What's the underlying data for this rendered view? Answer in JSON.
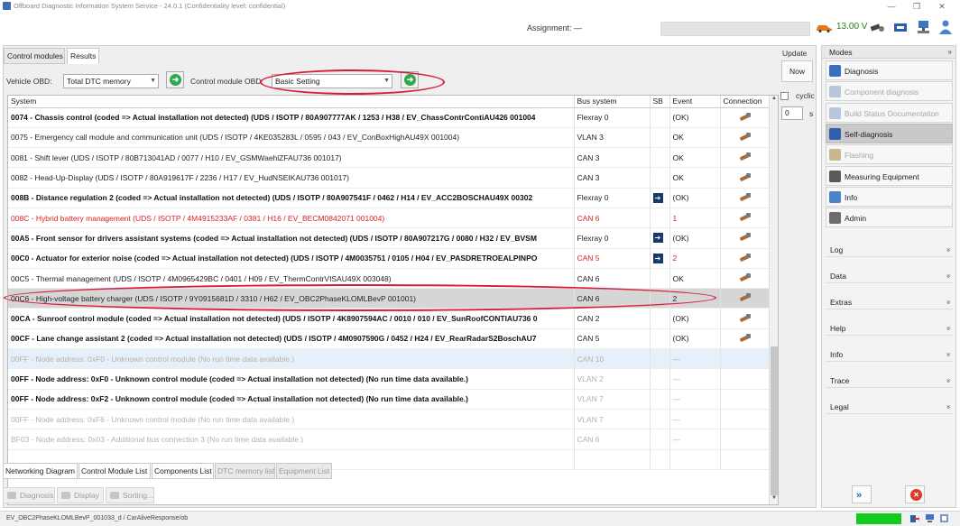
{
  "app": {
    "title": "Offboard Diagnostic Information System Service - 24.0.1 (Confidentiality level: confidential)",
    "window_buttons": [
      "—",
      "❐",
      "✕"
    ]
  },
  "topbar": {
    "assignment_label": "Assignment:  —",
    "assignment_value": "",
    "voltage": "13.00 V"
  },
  "tabs": [
    "Control modules",
    "Results"
  ],
  "filters": {
    "vehicle_obd_label": "Vehicle OBD:",
    "vehicle_obd_value": "Total DTC memory",
    "module_obd_label": "Control module OBD:",
    "module_obd_value": "Basic Setting"
  },
  "table": {
    "columns": [
      "System",
      "Bus system",
      "SB",
      "Event",
      "Connection"
    ],
    "rows": [
      {
        "system": "0074 - Chassis control  (coded => Actual installation not detected)  (UDS / ISOTP / 80A907777AK / 1253 / H38 / EV_ChassContrContiAU426 001004",
        "bus": "Flexray 0",
        "sb": false,
        "event": "(OK)",
        "style": "bold"
      },
      {
        "system": "0075 - Emergency call module and communication unit  (UDS / ISOTP / 4KE035283L / 0595 / 043 / EV_ConBoxHighAU49X 001004)",
        "bus": "VLAN 3",
        "sb": false,
        "event": "OK",
        "style": "normal"
      },
      {
        "system": "0081 - Shift lever  (UDS / ISOTP / 80B713041AD / 0077 / H10 / EV_GSMWaehlZFAU736 001017)",
        "bus": "CAN 3",
        "sb": false,
        "event": "OK",
        "style": "normal"
      },
      {
        "system": "0082 - Head-Up-Display  (UDS / ISOTP / 80A919617F / 2236 / H17 / EV_HudNSEIKAU736 001017)",
        "bus": "CAN 3",
        "sb": false,
        "event": "OK",
        "style": "normal"
      },
      {
        "system": "008B - Distance regulation 2  (coded => Actual installation not detected)  (UDS / ISOTP / 80A907541F / 0462 / H14 / EV_ACC2BOSCHAU49X 00302",
        "bus": "Flexray 0",
        "sb": true,
        "event": "(OK)",
        "style": "bold"
      },
      {
        "system": "008C - Hybrid battery management  (UDS / ISOTP / 4M4915233AF / 0381 / H16 / EV_BECM0842071 001004)",
        "bus": "CAN 6",
        "sb": false,
        "event": "1",
        "style": "red"
      },
      {
        "system": "00A5 - Front sensor for drivers assistant systems  (coded => Actual installation not detected)  (UDS / ISOTP / 80A907217G / 0080 / H32 / EV_BVSM",
        "bus": "Flexray 0",
        "sb": true,
        "event": "(OK)",
        "style": "bold"
      },
      {
        "system": "00C0 - Actuator for exterior noise  (coded => Actual installation not detected)  (UDS / ISOTP / 4M0035751 / 0105 / H04 / EV_PASDRETROEALPINPO",
        "bus": "CAN 5",
        "sb": true,
        "event": "2",
        "style": "redbold"
      },
      {
        "system": "00C5 - Thermal management  (UDS / ISOTP / 4M0965429BC / 0401 / H09 / EV_ThermContrVISAU49X 003048)",
        "bus": "CAN 6",
        "sb": false,
        "event": "OK",
        "style": "normal"
      },
      {
        "system": "00C6 - High-voltage battery charger  (UDS / ISOTP / 9Y0915681D / 3310 / H62 / EV_OBC2PhaseKLOMLBevP 001001)",
        "bus": "CAN 6",
        "sb": false,
        "event": "2",
        "style": "selected"
      },
      {
        "system": "00CA - Sunroof control module  (coded => Actual installation not detected)  (UDS / ISOTP / 4K8907594AC / 0010 / 010 / EV_SunRoofCONTIAU736 0",
        "bus": "CAN 2",
        "sb": false,
        "event": "(OK)",
        "style": "bold"
      },
      {
        "system": "00CF - Lane change assistant 2  (coded => Actual installation not detected)  (UDS / ISOTP / 4M0907590G / 0452 / H24 / EV_RearRadarS2BoschAU7",
        "bus": "CAN 5",
        "sb": false,
        "event": "(OK)",
        "style": "bold"
      },
      {
        "system": "00FF - Node address: 0xF0 - Unknown control module  (No run time data available.)",
        "bus": "CAN 10",
        "sb": false,
        "event": "—",
        "style": "grey-hl"
      },
      {
        "system": "00FF - Node address: 0xF0 - Unknown control module  (coded => Actual installation not detected)  (No run time data available.)",
        "bus": "VLAN 2",
        "sb": false,
        "event": "—",
        "style": "greybold"
      },
      {
        "system": "00FF - Node address: 0xF2 - Unknown control module  (coded => Actual installation not detected)  (No run time data available.)",
        "bus": "VLAN 7",
        "sb": false,
        "event": "—",
        "style": "greybold"
      },
      {
        "system": "00FF - Node address: 0xF6 - Unknown control module  (No run time data available.)",
        "bus": "VLAN 7",
        "sb": false,
        "event": "—",
        "style": "grey"
      },
      {
        "system": "BF03 - Node address: 0x03 - Additional bus connection 3  (No run time data available.)",
        "bus": "CAN 6",
        "sb": false,
        "event": "—",
        "style": "grey"
      },
      {
        "system": "",
        "bus": "",
        "sb": false,
        "event": "",
        "style": "empty"
      }
    ]
  },
  "update": {
    "label": "Update",
    "now_button": "Now",
    "cyclic_label": "cyclic",
    "seconds_value": "0",
    "seconds_unit": "s"
  },
  "bottom_tabs": [
    "Networking Diagram",
    "Control Module List",
    "Components List",
    "DTC memory list",
    "Equipment List"
  ],
  "actions": [
    "Diagnosis",
    "Display",
    "Sorting..."
  ],
  "right": {
    "modes_header": "Modes",
    "modes": [
      {
        "label": "Diagnosis",
        "state": "normal",
        "color": "#3a6fc2"
      },
      {
        "label": "Component diagnosis",
        "state": "dim",
        "color": "#b8c6dc"
      },
      {
        "label": "Build Status Documentation",
        "state": "dim",
        "color": "#b8c6dc"
      },
      {
        "label": "Self-diagnosis",
        "state": "active",
        "color": "#2f5fae"
      },
      {
        "label": "Flashing",
        "state": "dim",
        "color": "#c9b88a"
      },
      {
        "label": "Measuring Equipment",
        "state": "normal",
        "color": "#5a5a5a"
      },
      {
        "label": "Info",
        "state": "normal",
        "color": "#4b82c8"
      },
      {
        "label": "Admin",
        "state": "normal",
        "color": "#6d6d6d"
      }
    ],
    "sections": [
      "Log",
      "Data",
      "Extras",
      "Help",
      "Info",
      "Trace",
      "Legal"
    ]
  },
  "status": {
    "text": "EV_OBC2PhaseKLOMLBevP_001033_d / CarAliveResponse/ob",
    "green_color": "#12cc1c"
  }
}
